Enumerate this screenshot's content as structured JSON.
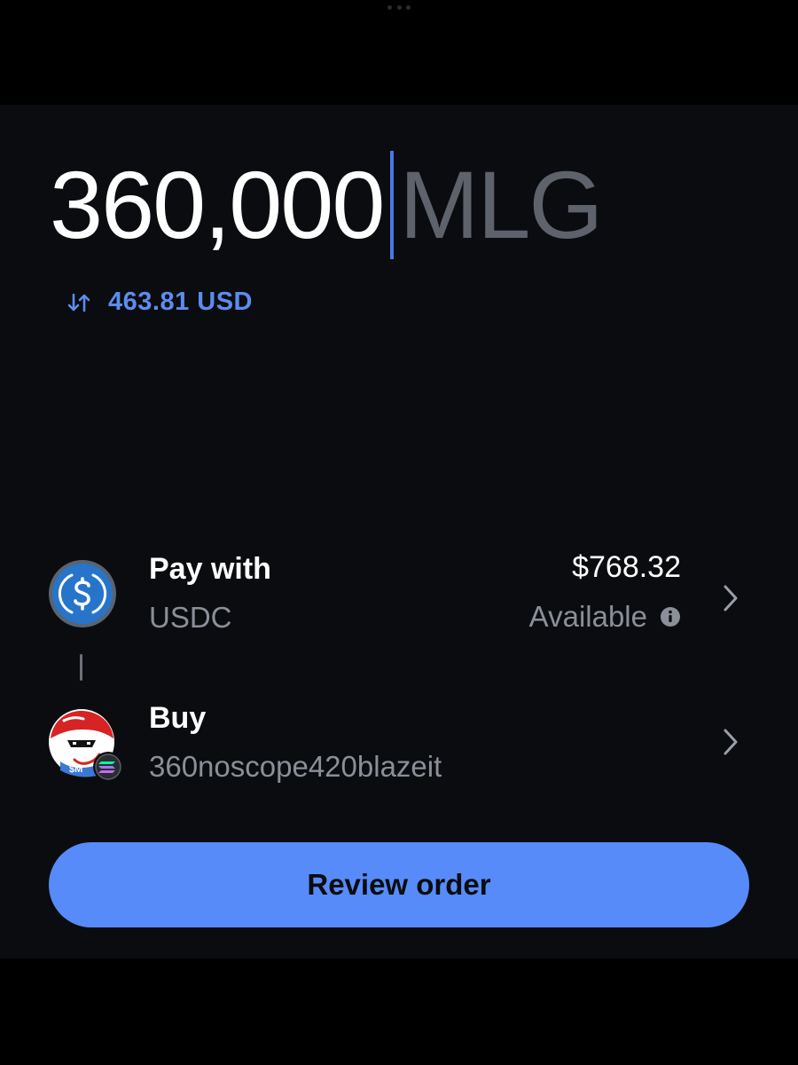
{
  "order": {
    "amount": "360,000",
    "unit": "MLG",
    "converted": "463.81 USD"
  },
  "pay_with": {
    "label": "Pay with",
    "asset": "USDC",
    "balance": "$768.32",
    "balance_label": "Available",
    "icon": "usdc-icon"
  },
  "buy": {
    "label": "Buy",
    "asset": "360noscope420blazeit",
    "icon": "mlg-token-icon",
    "network_icon": "solana-icon"
  },
  "review_button": {
    "label": "Review order"
  },
  "colors": {
    "accent": "#578bfa",
    "link_blue": "#5b8def",
    "background": "#0b0c0f",
    "muted_text": "#8a8f98",
    "usdc_blue": "#2775ca"
  }
}
